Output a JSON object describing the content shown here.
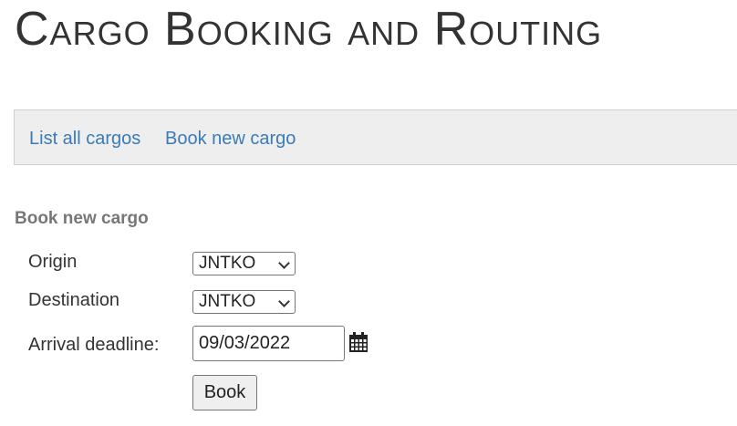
{
  "header": {
    "title": "Cargo Booking and Routing"
  },
  "nav": {
    "items": [
      {
        "label": "List all cargos"
      },
      {
        "label": "Book new cargo"
      }
    ]
  },
  "form": {
    "heading": "Book new cargo",
    "origin": {
      "label": "Origin",
      "value": "JNTKO"
    },
    "destination": {
      "label": "Destination",
      "value": "JNTKO"
    },
    "arrival_deadline": {
      "label": "Arrival deadline:",
      "value": "09/03/2022"
    },
    "submit_label": "Book"
  },
  "icons": {
    "calendar": "calendar-icon",
    "dropdown": "chevron-down-icon"
  },
  "colors": {
    "link": "#3a7bb8",
    "nav_background": "#eeeeee",
    "heading_gray": "#777777"
  }
}
